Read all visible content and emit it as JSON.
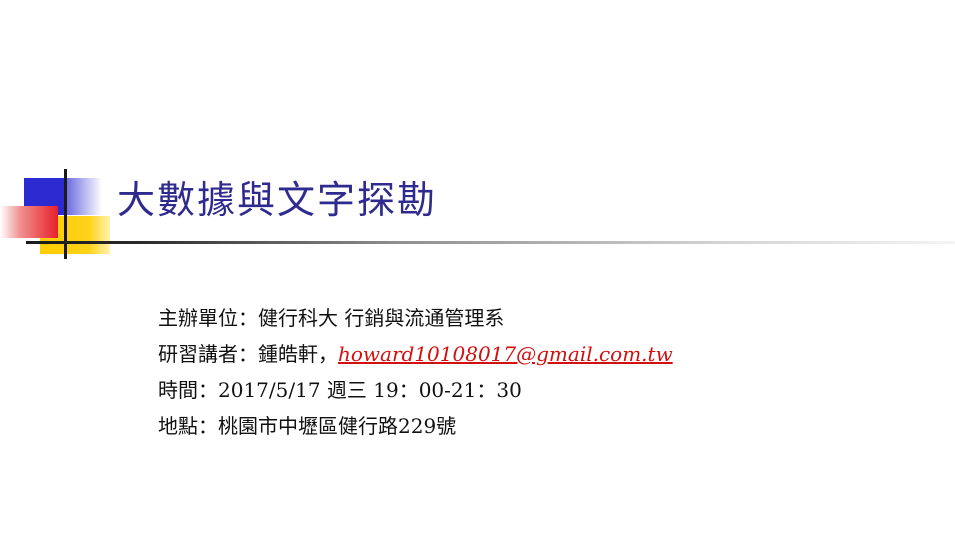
{
  "slide": {
    "title": "大數據與文字探勘",
    "organizer": "主辦單位：健行科大 行銷與流通管理系",
    "speaker_prefix": "研習講者：鍾皓軒，",
    "speaker_email": "howard10108017@gmail.com.tw",
    "time": "時間：2017/5/17 週三 19：00-21：30",
    "location": "地點：桃園市中壢區健行路229號"
  },
  "colors": {
    "title": "#2e2a8e",
    "email": "#d21010",
    "deco_blue": "#2b2bd1",
    "deco_red": "#e8202a",
    "deco_yellow": "#ffcc00"
  }
}
